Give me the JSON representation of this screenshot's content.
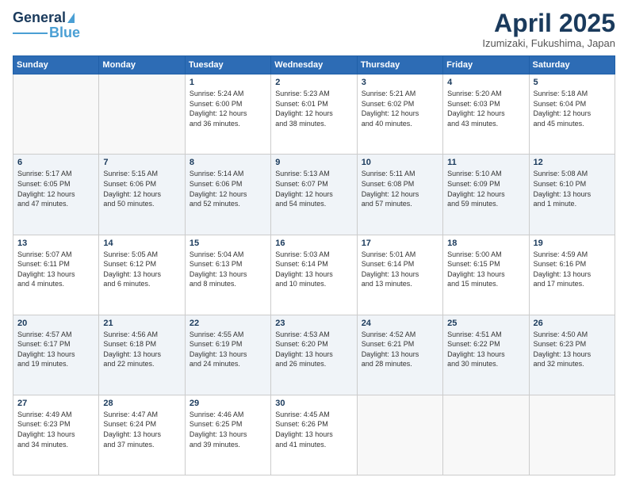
{
  "logo": {
    "text1": "General",
    "text2": "Blue"
  },
  "header": {
    "title": "April 2025",
    "location": "Izumizaki, Fukushima, Japan"
  },
  "weekdays": [
    "Sunday",
    "Monday",
    "Tuesday",
    "Wednesday",
    "Thursday",
    "Friday",
    "Saturday"
  ],
  "weeks": [
    [
      {
        "day": "",
        "info": ""
      },
      {
        "day": "",
        "info": ""
      },
      {
        "day": "1",
        "info": "Sunrise: 5:24 AM\nSunset: 6:00 PM\nDaylight: 12 hours\nand 36 minutes."
      },
      {
        "day": "2",
        "info": "Sunrise: 5:23 AM\nSunset: 6:01 PM\nDaylight: 12 hours\nand 38 minutes."
      },
      {
        "day": "3",
        "info": "Sunrise: 5:21 AM\nSunset: 6:02 PM\nDaylight: 12 hours\nand 40 minutes."
      },
      {
        "day": "4",
        "info": "Sunrise: 5:20 AM\nSunset: 6:03 PM\nDaylight: 12 hours\nand 43 minutes."
      },
      {
        "day": "5",
        "info": "Sunrise: 5:18 AM\nSunset: 6:04 PM\nDaylight: 12 hours\nand 45 minutes."
      }
    ],
    [
      {
        "day": "6",
        "info": "Sunrise: 5:17 AM\nSunset: 6:05 PM\nDaylight: 12 hours\nand 47 minutes."
      },
      {
        "day": "7",
        "info": "Sunrise: 5:15 AM\nSunset: 6:06 PM\nDaylight: 12 hours\nand 50 minutes."
      },
      {
        "day": "8",
        "info": "Sunrise: 5:14 AM\nSunset: 6:06 PM\nDaylight: 12 hours\nand 52 minutes."
      },
      {
        "day": "9",
        "info": "Sunrise: 5:13 AM\nSunset: 6:07 PM\nDaylight: 12 hours\nand 54 minutes."
      },
      {
        "day": "10",
        "info": "Sunrise: 5:11 AM\nSunset: 6:08 PM\nDaylight: 12 hours\nand 57 minutes."
      },
      {
        "day": "11",
        "info": "Sunrise: 5:10 AM\nSunset: 6:09 PM\nDaylight: 12 hours\nand 59 minutes."
      },
      {
        "day": "12",
        "info": "Sunrise: 5:08 AM\nSunset: 6:10 PM\nDaylight: 13 hours\nand 1 minute."
      }
    ],
    [
      {
        "day": "13",
        "info": "Sunrise: 5:07 AM\nSunset: 6:11 PM\nDaylight: 13 hours\nand 4 minutes."
      },
      {
        "day": "14",
        "info": "Sunrise: 5:05 AM\nSunset: 6:12 PM\nDaylight: 13 hours\nand 6 minutes."
      },
      {
        "day": "15",
        "info": "Sunrise: 5:04 AM\nSunset: 6:13 PM\nDaylight: 13 hours\nand 8 minutes."
      },
      {
        "day": "16",
        "info": "Sunrise: 5:03 AM\nSunset: 6:14 PM\nDaylight: 13 hours\nand 10 minutes."
      },
      {
        "day": "17",
        "info": "Sunrise: 5:01 AM\nSunset: 6:14 PM\nDaylight: 13 hours\nand 13 minutes."
      },
      {
        "day": "18",
        "info": "Sunrise: 5:00 AM\nSunset: 6:15 PM\nDaylight: 13 hours\nand 15 minutes."
      },
      {
        "day": "19",
        "info": "Sunrise: 4:59 AM\nSunset: 6:16 PM\nDaylight: 13 hours\nand 17 minutes."
      }
    ],
    [
      {
        "day": "20",
        "info": "Sunrise: 4:57 AM\nSunset: 6:17 PM\nDaylight: 13 hours\nand 19 minutes."
      },
      {
        "day": "21",
        "info": "Sunrise: 4:56 AM\nSunset: 6:18 PM\nDaylight: 13 hours\nand 22 minutes."
      },
      {
        "day": "22",
        "info": "Sunrise: 4:55 AM\nSunset: 6:19 PM\nDaylight: 13 hours\nand 24 minutes."
      },
      {
        "day": "23",
        "info": "Sunrise: 4:53 AM\nSunset: 6:20 PM\nDaylight: 13 hours\nand 26 minutes."
      },
      {
        "day": "24",
        "info": "Sunrise: 4:52 AM\nSunset: 6:21 PM\nDaylight: 13 hours\nand 28 minutes."
      },
      {
        "day": "25",
        "info": "Sunrise: 4:51 AM\nSunset: 6:22 PM\nDaylight: 13 hours\nand 30 minutes."
      },
      {
        "day": "26",
        "info": "Sunrise: 4:50 AM\nSunset: 6:23 PM\nDaylight: 13 hours\nand 32 minutes."
      }
    ],
    [
      {
        "day": "27",
        "info": "Sunrise: 4:49 AM\nSunset: 6:23 PM\nDaylight: 13 hours\nand 34 minutes."
      },
      {
        "day": "28",
        "info": "Sunrise: 4:47 AM\nSunset: 6:24 PM\nDaylight: 13 hours\nand 37 minutes."
      },
      {
        "day": "29",
        "info": "Sunrise: 4:46 AM\nSunset: 6:25 PM\nDaylight: 13 hours\nand 39 minutes."
      },
      {
        "day": "30",
        "info": "Sunrise: 4:45 AM\nSunset: 6:26 PM\nDaylight: 13 hours\nand 41 minutes."
      },
      {
        "day": "",
        "info": ""
      },
      {
        "day": "",
        "info": ""
      },
      {
        "day": "",
        "info": ""
      }
    ]
  ]
}
